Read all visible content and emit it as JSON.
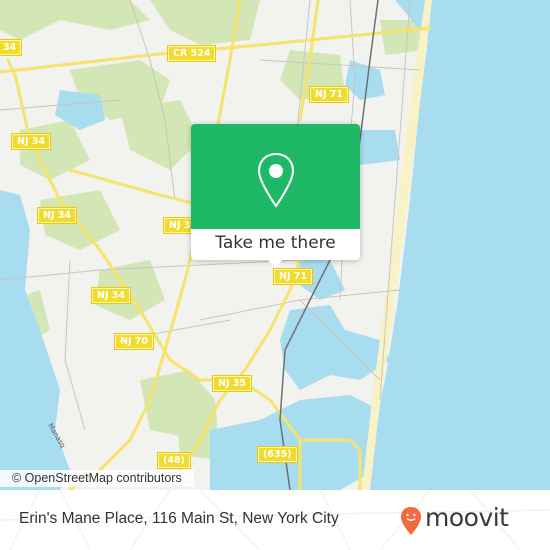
{
  "map": {
    "attribution": "© OpenStreetMap contributors",
    "colors": {
      "land": "#f2f2ef",
      "park": "#d3e6b6",
      "water": "#a8dcef",
      "beach": "#f9f2c4",
      "road": "#f6e36b",
      "minor_road": "#c8c6c0",
      "rail": "#707070"
    },
    "route_shields": [
      {
        "id": "nj34-a",
        "label": "34"
      },
      {
        "id": "cr524",
        "label": "CR 524"
      },
      {
        "id": "nj71-a",
        "label": "NJ 71"
      },
      {
        "id": "nj34-b",
        "label": "NJ 34"
      },
      {
        "id": "nj34-c",
        "label": "NJ 34"
      },
      {
        "id": "nj3x",
        "label": "NJ 3"
      },
      {
        "id": "nj34-d",
        "label": "NJ 34"
      },
      {
        "id": "nj71-b",
        "label": "NJ 71"
      },
      {
        "id": "nj70",
        "label": "NJ 70"
      },
      {
        "id": "nj35",
        "label": "NJ 35"
      },
      {
        "id": "r48",
        "label": "(48)"
      },
      {
        "id": "r635",
        "label": "(635)"
      }
    ],
    "place_labels": [
      {
        "id": "manasquan",
        "label": "Manasq"
      }
    ]
  },
  "popup": {
    "icon": "location-pin-icon",
    "button_label": "Take me there",
    "accent": "#1fb867"
  },
  "footer": {
    "place_text": "Erin's Mane Place, 116 Main St, New York City",
    "brand": "moovit",
    "brand_color": "#f26a3d"
  }
}
